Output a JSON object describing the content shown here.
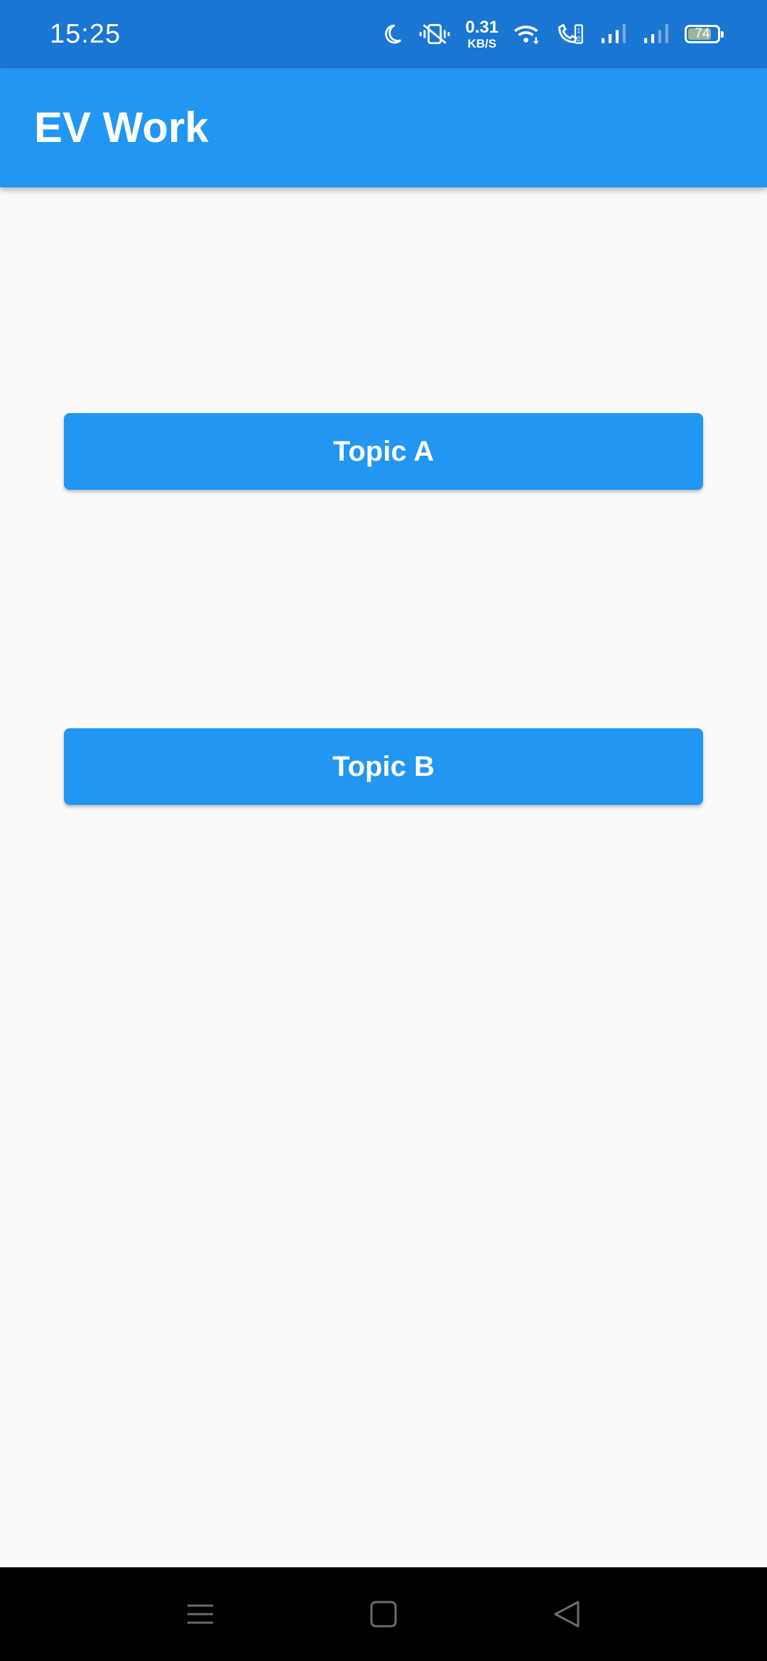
{
  "status_bar": {
    "time": "15:25",
    "net_speed_value": "0.31",
    "net_speed_unit": "KB/S",
    "battery_level": "74",
    "icons": [
      "moon-icon",
      "vibrate-icon",
      "wifi-icon",
      "wifi-calling-icon",
      "signal-sim1-icon",
      "signal-sim2-icon",
      "battery-icon"
    ]
  },
  "app_bar": {
    "title": "EV Work"
  },
  "main": {
    "buttons": [
      {
        "label": "Topic A"
      },
      {
        "label": "Topic B"
      }
    ]
  },
  "nav_bar": {
    "icons": [
      "menu-icon",
      "home-icon",
      "back-icon"
    ]
  },
  "colors": {
    "status_bar": "#1976d2",
    "primary": "#2196f3",
    "background": "#fafafa",
    "nav_bar": "#000000"
  }
}
